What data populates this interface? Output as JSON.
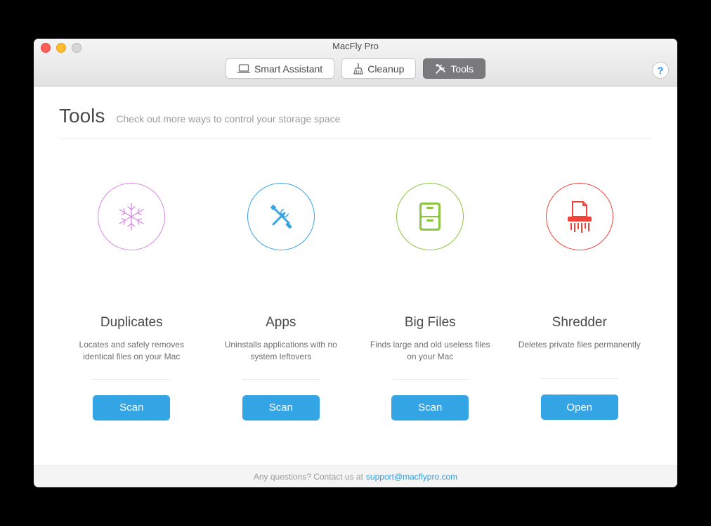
{
  "window": {
    "title": "MacFly Pro"
  },
  "tabs": {
    "smart_assistant": "Smart Assistant",
    "cleanup": "Cleanup",
    "tools": "Tools"
  },
  "help": "?",
  "page": {
    "title": "Tools",
    "subtitle": "Check out more ways to control your storage space"
  },
  "cards": {
    "duplicates": {
      "title": "Duplicates",
      "desc": "Locates and safely removes identical files on your Mac",
      "button": "Scan",
      "color": "#d987e6"
    },
    "apps": {
      "title": "Apps",
      "desc": "Uninstalls applications with no system leftovers",
      "button": "Scan",
      "color": "#37a5e4"
    },
    "bigfiles": {
      "title": "Big Files",
      "desc": "Finds large and old useless files on your Mac",
      "button": "Scan",
      "color": "#8bc53f"
    },
    "shredder": {
      "title": "Shredder",
      "desc": "Deletes private files permanently",
      "button": "Open",
      "color": "#f0443a"
    }
  },
  "footer": {
    "text": "Any questions? Contact us at",
    "link": "support@macflypro.com"
  }
}
